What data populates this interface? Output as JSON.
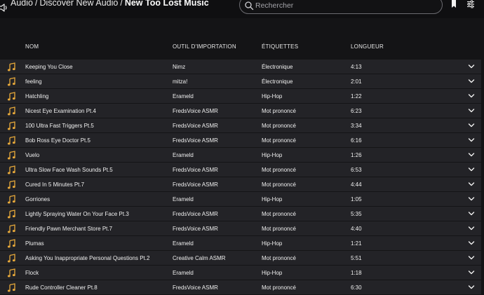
{
  "breadcrumb": {
    "root": "Audio",
    "parent": "Discover New Audio",
    "current": "New Too Lost Music",
    "separator": "/"
  },
  "search": {
    "placeholder": "Rechercher",
    "value": ""
  },
  "icons": {
    "speaker": "speaker-icon",
    "search": "search-icon",
    "bookmark": "bookmark-icon",
    "filters": "sliders-icon",
    "row": "music-note-icon",
    "expand": "chevron-down-icon"
  },
  "colors": {
    "accent": "#e8a93a",
    "row_bg": "#232327",
    "page_bg": "#141416"
  },
  "table": {
    "columns": [
      "NOM",
      "OUTIL D'IMPORTATION",
      "ÉTIQUETTES",
      "LONGUEUR"
    ],
    "rows": [
      {
        "name": "Keeping You Close",
        "uploader": "Nimz",
        "tag": "Électronique",
        "length": "4:13"
      },
      {
        "name": "feeling",
        "uploader": "mitza!",
        "tag": "Électronique",
        "length": "2:01"
      },
      {
        "name": "Hatchling",
        "uploader": "Erameld",
        "tag": "Hip-Hop",
        "length": "1:22"
      },
      {
        "name": "Nicest Eye Examination Pt.4",
        "uploader": "FredsVoice ASMR",
        "tag": "Mot prononcé",
        "length": "6:23"
      },
      {
        "name": "100 Ultra Fast Triggers Pt.5",
        "uploader": "FredsVoice ASMR",
        "tag": "Mot prononcé",
        "length": "3:34"
      },
      {
        "name": "Bob Ross Eye Doctor Pt.5",
        "uploader": "FredsVoice ASMR",
        "tag": "Mot prononcé",
        "length": "6:16"
      },
      {
        "name": "Vuelo",
        "uploader": "Erameld",
        "tag": "Hip-Hop",
        "length": "1:26"
      },
      {
        "name": "Ultra Slow Face Wash Sounds Pt.5",
        "uploader": "FredsVoice ASMR",
        "tag": "Mot prononcé",
        "length": "6:53"
      },
      {
        "name": "Cured In 5 Minutes Pt.7",
        "uploader": "FredsVoice ASMR",
        "tag": "Mot prononcé",
        "length": "4:44"
      },
      {
        "name": "Gorriones",
        "uploader": "Erameld",
        "tag": "Hip-Hop",
        "length": "1:05"
      },
      {
        "name": "Lightly Spraying Water On Your Face Pt.3",
        "uploader": "FredsVoice ASMR",
        "tag": "Mot prononcé",
        "length": "5:35"
      },
      {
        "name": "Friendly Pawn Merchant Store Pt.7",
        "uploader": "FredsVoice ASMR",
        "tag": "Mot prononcé",
        "length": "4:40"
      },
      {
        "name": "Plumas",
        "uploader": "Erameld",
        "tag": "Hip-Hop",
        "length": "1:21"
      },
      {
        "name": "Asking You Inappropriate Personal Questions Pt.2",
        "uploader": "Creative Calm ASMR",
        "tag": "Mot prononcé",
        "length": "5:51"
      },
      {
        "name": "Flock",
        "uploader": "Erameld",
        "tag": "Hip-Hop",
        "length": "1:18"
      },
      {
        "name": "Rude Controller Cleaner Pt.8",
        "uploader": "FredsVoice ASMR",
        "tag": "Mot prononcé",
        "length": "6:30"
      }
    ]
  }
}
